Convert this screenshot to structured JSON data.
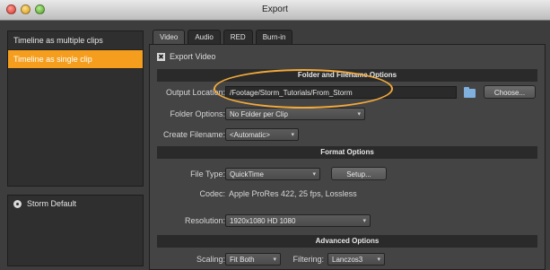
{
  "window": {
    "title": "Export"
  },
  "left_panel": {
    "items": [
      {
        "label": "Timeline as multiple clips",
        "selected": false
      },
      {
        "label": "Timeline as single clip",
        "selected": true
      }
    ],
    "preset": {
      "label": "Storm Default",
      "icon": "storm-icon"
    }
  },
  "tabs": [
    {
      "label": "Video",
      "active": true
    },
    {
      "label": "Audio",
      "active": false
    },
    {
      "label": "RED",
      "active": false
    },
    {
      "label": "Burn-in",
      "active": false
    }
  ],
  "export_video": {
    "mark": "✖",
    "label": "Export Video",
    "checked": true
  },
  "sections": {
    "folder": "Folder and Filename Options",
    "format": "Format Options",
    "advanced": "Advanced Options"
  },
  "output_location": {
    "label": "Output Location:",
    "value": "/Footage/Storm_Tutorials/From_Storm"
  },
  "choose_button": "Choose...",
  "folder_options": {
    "label": "Folder Options:",
    "value": "No Folder per Clip"
  },
  "create_filename": {
    "label": "Create Filename:",
    "value": "<Automatic>"
  },
  "file_type": {
    "label": "File Type:",
    "value": "QuickTime"
  },
  "setup_button": "Setup...",
  "codec": {
    "label": "Codec:",
    "value": "Apple ProRes 422, 25 fps, Lossless"
  },
  "resolution": {
    "label": "Resolution:",
    "value": "1920x1080 HD 1080"
  },
  "scaling": {
    "label": "Scaling:",
    "value": "Fit Both"
  },
  "filtering": {
    "label": "Filtering:",
    "value": "Lanczos3"
  },
  "colors": {
    "accent": "#f59e1e",
    "highlight_oval": "#f2a93b"
  }
}
